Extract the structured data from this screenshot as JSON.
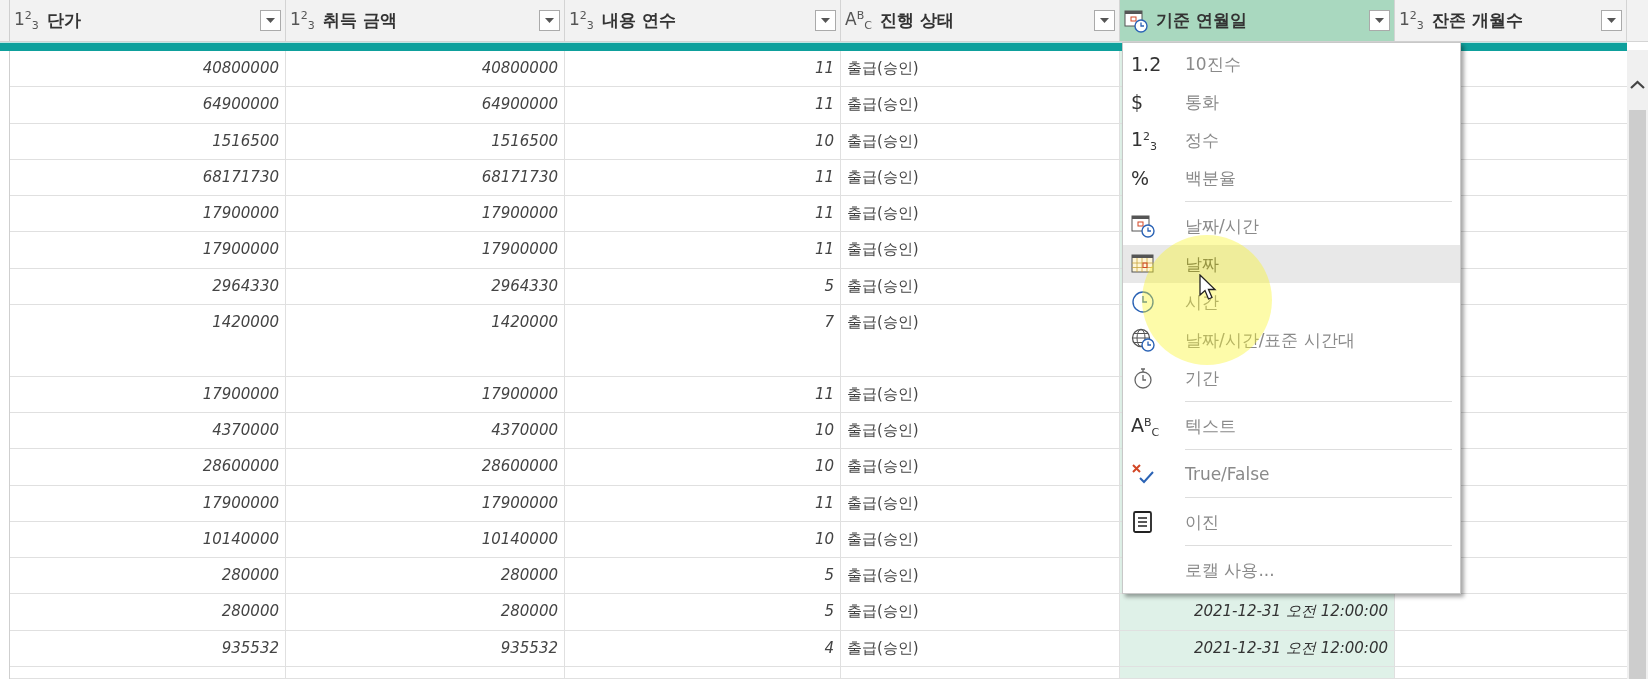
{
  "columns": [
    {
      "kind": "glyph",
      "type_glyph": "1$^{2}$$_{3}$",
      "label": "단가",
      "selected": false
    },
    {
      "kind": "glyph",
      "type_glyph": "1$^{2}$$_{3}$",
      "label": "취득 금액",
      "selected": false
    },
    {
      "kind": "glyph",
      "type_glyph": "1$^{2}$$_{3}$",
      "label": "내용 연수",
      "selected": false
    },
    {
      "kind": "glyph",
      "type_glyph": "A$^{B}$$_{C}$",
      "label": "진행 상태",
      "selected": false
    },
    {
      "kind": "datetime",
      "label": "기준 연월일",
      "selected": true
    },
    {
      "kind": "glyph",
      "type_glyph": "1$^{2}$$_{3}$",
      "label": "잔존 개월수",
      "selected": false
    }
  ],
  "rows": [
    {
      "tall": false,
      "cells": [
        "40800000",
        "40800000",
        "11",
        "출급(승인)"
      ]
    },
    {
      "tall": false,
      "cells": [
        "64900000",
        "64900000",
        "11",
        "출급(승인)"
      ]
    },
    {
      "tall": false,
      "cells": [
        "1516500",
        "1516500",
        "10",
        "출급(승인)"
      ]
    },
    {
      "tall": false,
      "cells": [
        "68171730",
        "68171730",
        "11",
        "출급(승인)"
      ]
    },
    {
      "tall": false,
      "cells": [
        "17900000",
        "17900000",
        "11",
        "출급(승인)"
      ]
    },
    {
      "tall": false,
      "cells": [
        "17900000",
        "17900000",
        "11",
        "출급(승인)"
      ]
    },
    {
      "tall": false,
      "cells": [
        "2964330",
        "2964330",
        "5",
        "출급(승인)"
      ]
    },
    {
      "tall": true,
      "cells": [
        "1420000",
        "1420000",
        "7",
        "출급(승인)"
      ]
    },
    {
      "tall": false,
      "cells": [
        "17900000",
        "17900000",
        "11",
        "출급(승인)"
      ]
    },
    {
      "tall": false,
      "cells": [
        "4370000",
        "4370000",
        "10",
        "출급(승인)"
      ]
    },
    {
      "tall": false,
      "cells": [
        "28600000",
        "28600000",
        "10",
        "출급(승인)"
      ]
    },
    {
      "tall": false,
      "cells": [
        "17900000",
        "17900000",
        "11",
        "출급(승인)"
      ]
    },
    {
      "tall": false,
      "cells": [
        "10140000",
        "10140000",
        "10",
        "출급(승인)"
      ]
    },
    {
      "tall": false,
      "cells": [
        "280000",
        "280000",
        "5",
        "출급(승인)"
      ]
    },
    {
      "tall": false,
      "cells": [
        "280000",
        "280000",
        "5",
        "출급(승인)",
        "2021-12-31 오전 12:00:00"
      ]
    },
    {
      "tall": false,
      "cells": [
        "935532",
        "935532",
        "4",
        "출급(승인)",
        "2021-12-31 오전 12:00:00"
      ]
    }
  ],
  "type_menu": [
    {
      "kind": "glyph",
      "glyph": "1.2",
      "label": "10진수",
      "selected": false
    },
    {
      "kind": "glyph",
      "glyph": "$",
      "label": "통화",
      "selected": false
    },
    {
      "kind": "glyph",
      "glyph": "1$^{2}$$_{3}$",
      "label": "정수",
      "selected": false
    },
    {
      "kind": "glyph",
      "glyph": "%",
      "label": "백분율",
      "selected": false
    },
    {
      "kind": "separator"
    },
    {
      "kind": "datetime",
      "label": "날짜/시간",
      "selected": false
    },
    {
      "kind": "date",
      "label": "날짜",
      "selected": true
    },
    {
      "kind": "time",
      "label": "시간",
      "selected": false
    },
    {
      "kind": "timezone",
      "label": "날짜/시간/표준 시간대",
      "selected": false
    },
    {
      "kind": "duration",
      "label": "기간",
      "selected": false
    },
    {
      "kind": "separator"
    },
    {
      "kind": "glyph",
      "glyph": "A$^{B}$$_{C}$",
      "label": "텍스트",
      "selected": false
    },
    {
      "kind": "separator"
    },
    {
      "kind": "truefalse",
      "label": "True/False",
      "selected": false
    },
    {
      "kind": "separator"
    },
    {
      "kind": "binary",
      "label": "이진",
      "selected": false
    },
    {
      "kind": "separator"
    },
    {
      "kind": "plain",
      "label": "로캘 사용...",
      "selected": false
    }
  ]
}
